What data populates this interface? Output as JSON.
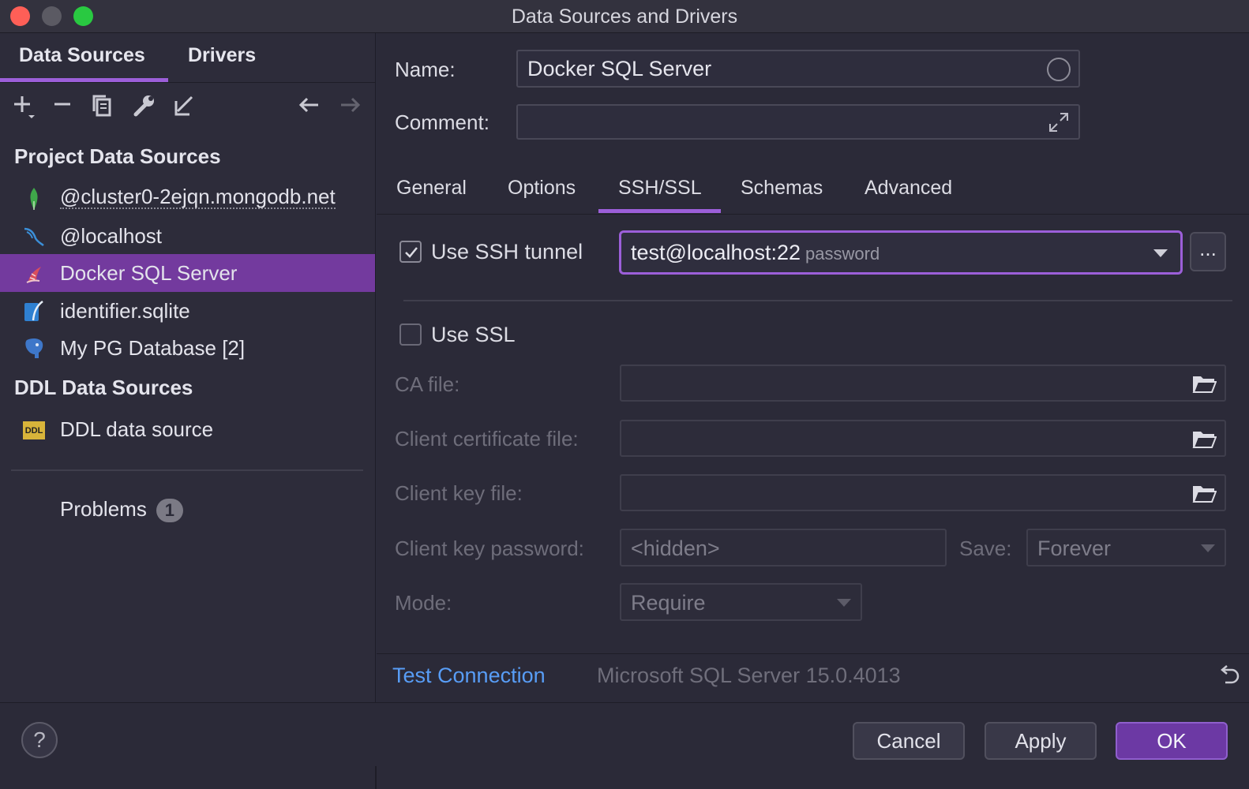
{
  "window": {
    "title": "Data Sources and Drivers"
  },
  "left": {
    "tabs": {
      "data_sources": "Data Sources",
      "drivers": "Drivers"
    },
    "toolbar": [
      "add-icon",
      "remove-icon",
      "duplicate-icon",
      "wrench-icon",
      "import-icon",
      "back-arrow-icon",
      "forward-arrow-icon"
    ],
    "project_title": "Project Data Sources",
    "project_items": [
      {
        "label": "@cluster0-2ejqn.mongodb.net",
        "icon": "mongodb-icon"
      },
      {
        "label": "@localhost",
        "icon": "mysql-icon"
      },
      {
        "label": "Docker SQL Server",
        "icon": "sql-server-icon",
        "selected": true
      },
      {
        "label": "identifier.sqlite",
        "icon": "sqlite-icon"
      },
      {
        "label": "My PG Database [2]",
        "icon": "postgresql-icon"
      }
    ],
    "ddl_title": "DDL Data Sources",
    "ddl_items": [
      {
        "label": "DDL data source",
        "icon": "ddl-icon",
        "icon_text": "DDL"
      }
    ],
    "problems": {
      "label": "Problems",
      "count": "1"
    }
  },
  "form": {
    "name_label": "Name:",
    "name_value": "Docker SQL Server",
    "comment_label": "Comment:",
    "comment_value": ""
  },
  "tabs": [
    "General",
    "Options",
    "SSH/SSL",
    "Schemas",
    "Advanced"
  ],
  "active_tab": "SSH/SSL",
  "ssh": {
    "use_label": "Use SSH tunnel",
    "checked": true,
    "value": "test@localhost:22",
    "auth": "password",
    "more_label": "..."
  },
  "ssl": {
    "use_label": "Use SSL",
    "checked": false,
    "ca_label": "CA file:",
    "cert_label": "Client certificate file:",
    "key_label": "Client key file:",
    "key_pass_label": "Client key password:",
    "key_pass_value": "<hidden>",
    "save_label": "Save:",
    "save_value": "Forever",
    "mode_label": "Mode:",
    "mode_value": "Require"
  },
  "status": {
    "test_connection": "Test Connection",
    "version": "Microsoft SQL Server 15.0.4013"
  },
  "footer": {
    "help": "?",
    "cancel": "Cancel",
    "apply": "Apply",
    "ok": "OK"
  },
  "colors": {
    "accent": "#9c5fd9",
    "selection": "#733a9e",
    "link": "#589df6"
  }
}
